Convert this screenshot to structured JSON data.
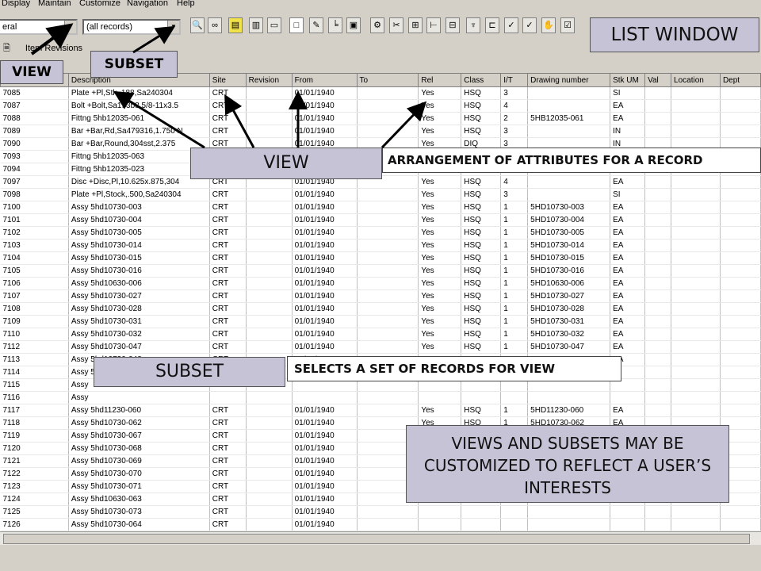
{
  "menu": {
    "items": [
      "Display",
      "Maintain",
      "Customize",
      "Navigation",
      "Help"
    ]
  },
  "toolbar": {
    "view_combo": "eral",
    "subset_combo": "(all records)"
  },
  "sublabel": "Item Revisions",
  "columns": [
    "",
    "Description",
    "Site",
    "Revision",
    "From",
    "To",
    "Rel",
    "Class",
    "I/T",
    "Drawing number",
    "Stk UM",
    "Val",
    "Location",
    "Dept"
  ],
  "rows": [
    [
      "7085",
      "Plate +Pl,Stk,.188,Sa240304",
      "CRT",
      "",
      "01/01/1940",
      "",
      "Yes",
      "HSQ",
      "3",
      "",
      "SI",
      "",
      "",
      ""
    ],
    [
      "7087",
      "Bolt  +Bolt,Sa193b8,5/8-11x3.5",
      "CRT",
      "",
      "01/01/1940",
      "",
      "Yes",
      "HSQ",
      "4",
      "",
      "EA",
      "",
      "",
      ""
    ],
    [
      "7088",
      "Fittng 5hb12035-061",
      "CRT",
      "",
      "01/01/1940",
      "",
      "Yes",
      "HSQ",
      "2",
      "5HB12035-061",
      "EA",
      "",
      "",
      ""
    ],
    [
      "7089",
      "Bar   +Bar,Rd,Sa479316,1.750 N",
      "CRT",
      "",
      "01/01/1940",
      "",
      "Yes",
      "HSQ",
      "3",
      "",
      "IN",
      "",
      "",
      ""
    ],
    [
      "7090",
      "Bar   +Bar,Round,304sst,2.375",
      "CRT",
      "",
      "01/01/1940",
      "",
      "Yes",
      "DIQ",
      "3",
      "",
      "IN",
      "",
      "",
      ""
    ],
    [
      "7093",
      "Fittng 5hb12035-063",
      "CRT",
      "",
      "01/01/1940",
      "",
      "Yes",
      "HSQ",
      "",
      "",
      "",
      "",
      "",
      ""
    ],
    [
      "7094",
      "Fittng 5hb12035-023",
      "CRT",
      "",
      "01/01/1940",
      "",
      "Yes",
      "HSQ",
      "",
      "",
      "",
      "",
      "",
      ""
    ],
    [
      "7097",
      "Disc  +Disc,Pl,10.625x.875,304",
      "CRT",
      "",
      "01/01/1940",
      "",
      "Yes",
      "HSQ",
      "4",
      "",
      "EA",
      "",
      "",
      ""
    ],
    [
      "7098",
      "Plate +Pl,Stock,.500,Sa240304",
      "CRT",
      "",
      "01/01/1940",
      "",
      "Yes",
      "HSQ",
      "3",
      "",
      "SI",
      "",
      "",
      ""
    ],
    [
      "7100",
      "Assy  5hd10730-003",
      "CRT",
      "",
      "01/01/1940",
      "",
      "Yes",
      "HSQ",
      "1",
      "5HD10730-003",
      "EA",
      "",
      "",
      ""
    ],
    [
      "7101",
      "Assy  5hd10730-004",
      "CRT",
      "",
      "01/01/1940",
      "",
      "Yes",
      "HSQ",
      "1",
      "5HD10730-004",
      "EA",
      "",
      "",
      ""
    ],
    [
      "7102",
      "Assy  5hd10730-005",
      "CRT",
      "",
      "01/01/1940",
      "",
      "Yes",
      "HSQ",
      "1",
      "5HD10730-005",
      "EA",
      "",
      "",
      ""
    ],
    [
      "7103",
      "Assy  5hd10730-014",
      "CRT",
      "",
      "01/01/1940",
      "",
      "Yes",
      "HSQ",
      "1",
      "5HD10730-014",
      "EA",
      "",
      "",
      ""
    ],
    [
      "7104",
      "Assy  5hd10730-015",
      "CRT",
      "",
      "01/01/1940",
      "",
      "Yes",
      "HSQ",
      "1",
      "5HD10730-015",
      "EA",
      "",
      "",
      ""
    ],
    [
      "7105",
      "Assy  5hd10730-016",
      "CRT",
      "",
      "01/01/1940",
      "",
      "Yes",
      "HSQ",
      "1",
      "5HD10730-016",
      "EA",
      "",
      "",
      ""
    ],
    [
      "7106",
      "Assy  5hd10630-006",
      "CRT",
      "",
      "01/01/1940",
      "",
      "Yes",
      "HSQ",
      "1",
      "5HD10630-006",
      "EA",
      "",
      "",
      ""
    ],
    [
      "7107",
      "Assy  5hd10730-027",
      "CRT",
      "",
      "01/01/1940",
      "",
      "Yes",
      "HSQ",
      "1",
      "5HD10730-027",
      "EA",
      "",
      "",
      ""
    ],
    [
      "7108",
      "Assy  5hd10730-028",
      "CRT",
      "",
      "01/01/1940",
      "",
      "Yes",
      "HSQ",
      "1",
      "5HD10730-028",
      "EA",
      "",
      "",
      ""
    ],
    [
      "7109",
      "Assy  5hd10730-031",
      "CRT",
      "",
      "01/01/1940",
      "",
      "Yes",
      "HSQ",
      "1",
      "5HD10730-031",
      "EA",
      "",
      "",
      ""
    ],
    [
      "7110",
      "Assy  5hd10730-032",
      "CRT",
      "",
      "01/01/1940",
      "",
      "Yes",
      "HSQ",
      "1",
      "5HD10730-032",
      "EA",
      "",
      "",
      ""
    ],
    [
      "7112",
      "Assy  5hd10730-047",
      "CRT",
      "",
      "01/01/1940",
      "",
      "Yes",
      "HSQ",
      "1",
      "5HD10730-047",
      "EA",
      "",
      "",
      ""
    ],
    [
      "7113",
      "Assy  5hd10730-048",
      "CRT",
      "",
      "01/01/1940",
      "",
      "Yes",
      "HSQ",
      "1",
      "5HD10730-048",
      "EA",
      "",
      "",
      ""
    ],
    [
      "7114",
      "Assy  5hd11230-039",
      "",
      "",
      "",
      "",
      "",
      "",
      "",
      "",
      "",
      "",
      "",
      ""
    ],
    [
      "7115",
      "Assy",
      "",
      "",
      "",
      "",
      "",
      "",
      "",
      "",
      "",
      "",
      "",
      ""
    ],
    [
      "7116",
      "Assy",
      "",
      "",
      "",
      "",
      "",
      "",
      "",
      "",
      "",
      "",
      "",
      ""
    ],
    [
      "7117",
      "Assy  5hd11230-060",
      "CRT",
      "",
      "01/01/1940",
      "",
      "Yes",
      "HSQ",
      "1",
      "5HD11230-060",
      "EA",
      "",
      "",
      ""
    ],
    [
      "7118",
      "Assy  5hd10730-062",
      "CRT",
      "",
      "01/01/1940",
      "",
      "Yes",
      "HSQ",
      "1",
      "5HD10730-062",
      "EA",
      "",
      "",
      ""
    ],
    [
      "7119",
      "Assy  5hd10730-067",
      "CRT",
      "",
      "01/01/1940",
      "",
      "Yes",
      "HSQ",
      "1",
      "5HD10730-067",
      "EA",
      "",
      "",
      ""
    ],
    [
      "7120",
      "Assy  5hd10730-068",
      "CRT",
      "",
      "01/01/1940",
      "",
      "",
      "",
      "",
      "",
      "",
      "",
      "",
      ""
    ],
    [
      "7121",
      "Assy  5hd10730-069",
      "CRT",
      "",
      "01/01/1940",
      "",
      "",
      "",
      "",
      "",
      "",
      "",
      "",
      ""
    ],
    [
      "7122",
      "Assy  5hd10730-070",
      "CRT",
      "",
      "01/01/1940",
      "",
      "",
      "",
      "",
      "",
      "",
      "",
      "",
      ""
    ],
    [
      "7123",
      "Assy  5hd10730-071",
      "CRT",
      "",
      "01/01/1940",
      "",
      "",
      "",
      "",
      "",
      "",
      "",
      "",
      ""
    ],
    [
      "7124",
      "Assy  5hd10630-063",
      "CRT",
      "",
      "01/01/1940",
      "",
      "",
      "",
      "",
      "",
      "",
      "",
      "",
      ""
    ],
    [
      "7125",
      "Assy  5hd10730-073",
      "CRT",
      "",
      "01/01/1940",
      "",
      "",
      "",
      "",
      "",
      "",
      "",
      "",
      ""
    ],
    [
      "7126",
      "Assy  5hd10730-064",
      "CRT",
      "",
      "01/01/1940",
      "",
      "",
      "",
      "",
      "",
      "",
      "",
      "",
      ""
    ],
    [
      "7127",
      "Assy  5hd11230-074",
      "CRT",
      "",
      "01/01/1940",
      "",
      "Yes",
      "HSQ",
      "1",
      "5HD11230-074",
      "EA",
      "",
      "",
      ""
    ],
    [
      "7128",
      "Assy  5hd10730-075",
      "CRT",
      "",
      "01/01/1940",
      "",
      "Yes",
      "HSQ",
      "1",
      "5HD10730-075",
      "EA",
      "",
      "",
      ""
    ]
  ],
  "annotations": {
    "list_window": "LIST WINDOW",
    "view_small": "VIEW",
    "subset_small": "SUBSET",
    "view_callout": "VIEW",
    "arrangement_note": "ARRANGEMENT OF ATTRIBUTES FOR A RECORD",
    "subset_callout": "SUBSET",
    "selects_note": "SELECTS A SET OF RECORDS FOR VIEW",
    "customize_note": "VIEWS AND SUBSETS MAY BE CUSTOMIZED TO REFLECT A USER’S INTERESTS"
  },
  "colors": {
    "callout_bg": "#c6c3d6",
    "arrow": "#000000"
  }
}
